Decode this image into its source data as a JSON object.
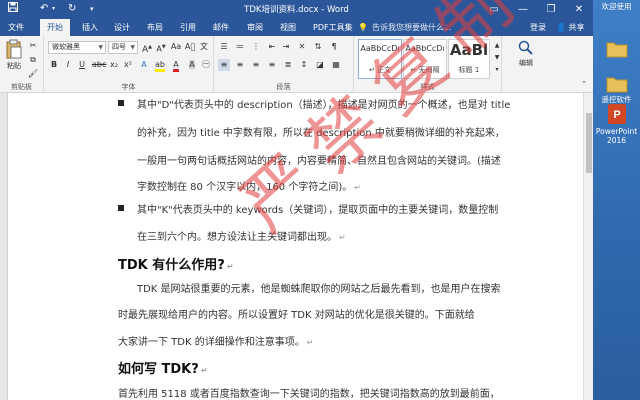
{
  "window": {
    "title": "TDK培训资料.docx - Word",
    "qat": {
      "save_icon": "save-icon",
      "undo": "↶",
      "redo": "↻"
    },
    "controls": {
      "minimize": "—",
      "restore": "❐",
      "close": "✕"
    }
  },
  "tabs": [
    "文件",
    "开始",
    "插入",
    "设计",
    "布局",
    "引用",
    "邮件",
    "审阅",
    "视图",
    "PDF工具集"
  ],
  "active_tab": "开始",
  "tell_me": "告诉我您想要做什么...",
  "account": {
    "login": "登录",
    "share": "共享"
  },
  "ribbon": {
    "clipboard": {
      "paste": "粘贴",
      "label": "剪贴板"
    },
    "font": {
      "name": "微软雅黑",
      "size": "四号",
      "label": "字体"
    },
    "paragraph": {
      "label": "段落"
    },
    "styles": {
      "label": "样式",
      "items": [
        {
          "sample": "AaBbCcDı",
          "name": "↵ 正文"
        },
        {
          "sample": "AaBbCcDı",
          "name": "↵ 无间隔"
        },
        {
          "sample": "AaBl",
          "name": "标题 1"
        }
      ]
    },
    "editing": {
      "label": "编辑"
    }
  },
  "document": {
    "bullets": [
      {
        "lines": [
          "其中\"D\"代表页头中的 description（描述），描述是对网页的一个概述，也是对 title",
          "的补充，因为 title 中字数有限，所以在 description 中就要稍微详细的补充起来，",
          "一般用一句两句话概括网站的内容，内容要精简、自然且包含网站的关键词。(描述",
          "字数控制在 80 个汉字以内，160 个字符之间)。"
        ]
      },
      {
        "lines": [
          "其中\"K\"代表页头中的 keywords（关键词），提取页面中的主要关键词，数量控制",
          "在三到六个内。想方设法让主关键词都出现。"
        ]
      }
    ],
    "heading1": "TDK 有什么作用?",
    "para1": [
      "TDK 是网站很重要的元素，他是蜘蛛爬取你的网站之后最先看到，也是用户在搜索",
      "时最先展现给用户的内容。所以设置好 TDK 对网站的优化是很关键的。下面就给",
      "大家讲一下 TDK 的详细操作和注意事项。"
    ],
    "heading2": "如何写 TDK?",
    "para2": "首先利用 5118 或者百度指数查询一下关键词的指数，把关键词指数高的放到最前面，"
  },
  "watermark": "严禁复制",
  "desktop": {
    "icons": [
      {
        "label": "",
        "icon": "folder-icon"
      },
      {
        "label": "遥控软件",
        "icon": "folder-icon"
      },
      {
        "label": "PowerPoint 2016",
        "icon": "powerpoint-icon"
      }
    ],
    "top_label": "欢迎使用"
  }
}
